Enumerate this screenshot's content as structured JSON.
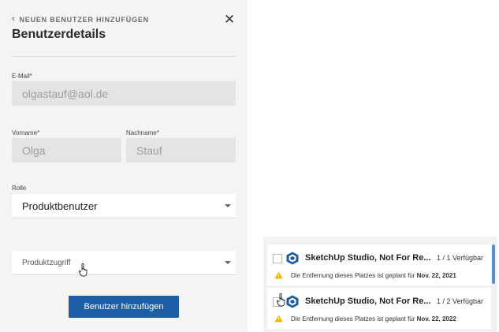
{
  "header": {
    "back_label": "NEUEN BENUTZER HINZUFÜGEN",
    "title": "Benutzerdetails"
  },
  "form": {
    "email_label": "E-Mail*",
    "email_value": "olgastauf@aol.de",
    "firstname_label": "Vorname*",
    "firstname_value": "Olga",
    "lastname_label": "Nachname*",
    "lastname_value": "Stauf",
    "role_label": "Rolle",
    "role_value": "Produktbenutzer",
    "product_access_placeholder": "Produktzugriff",
    "submit_label": "Benutzer hinzufügen"
  },
  "product_list": {
    "items": [
      {
        "name": "SketchUp Studio, Not For Re...",
        "availability": "1 / 1 Verfügbar",
        "note": "Die Entfernung dieses Platzes ist geplant für ",
        "date": "Nov. 22, 2021"
      },
      {
        "name": "SketchUp Studio, Not For Re...",
        "availability": "1 / 2 Verfügbar",
        "note": "Die Entfernung dieses Platzes ist geplant für ",
        "date": "Nov. 22, 2022"
      }
    ]
  },
  "colors": {
    "primary": "#1d5fa6",
    "warning": "#f0b400",
    "logo": "#1a5a9e"
  }
}
